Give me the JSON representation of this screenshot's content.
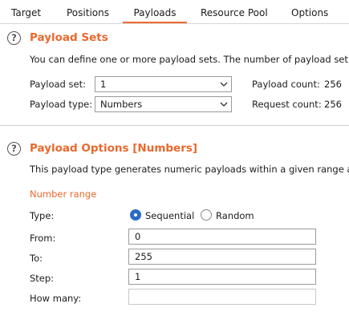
{
  "tabs": [
    "Target",
    "Positions",
    "Payloads",
    "Resource Pool",
    "Options"
  ],
  "active_tab": "Payloads",
  "accent_color": "#e8692d",
  "payload_sets": {
    "help_icon": "question-circle-icon",
    "title": "Payload Sets",
    "description": "You can define one or more payload sets. The number of payload set",
    "set_label": "Payload set:",
    "set_value": "1",
    "type_label": "Payload type:",
    "type_value": "Numbers",
    "payload_count_label": "Payload count:",
    "payload_count": "256",
    "request_count_label": "Request count:",
    "request_count": "256"
  },
  "payload_options": {
    "help_icon": "question-circle-icon",
    "title": "Payload Options [Numbers]",
    "description": "This payload type generates numeric payloads within a given range a",
    "number_range_label": "Number range",
    "type_label": "Type:",
    "radio_sequential": "Sequential",
    "radio_random": "Random",
    "selected_type": "Sequential",
    "from_label": "From:",
    "from_value": "0",
    "to_label": "To:",
    "to_value": "255",
    "step_label": "Step:",
    "step_value": "1",
    "how_many_label": "How many:",
    "how_many_value": ""
  }
}
